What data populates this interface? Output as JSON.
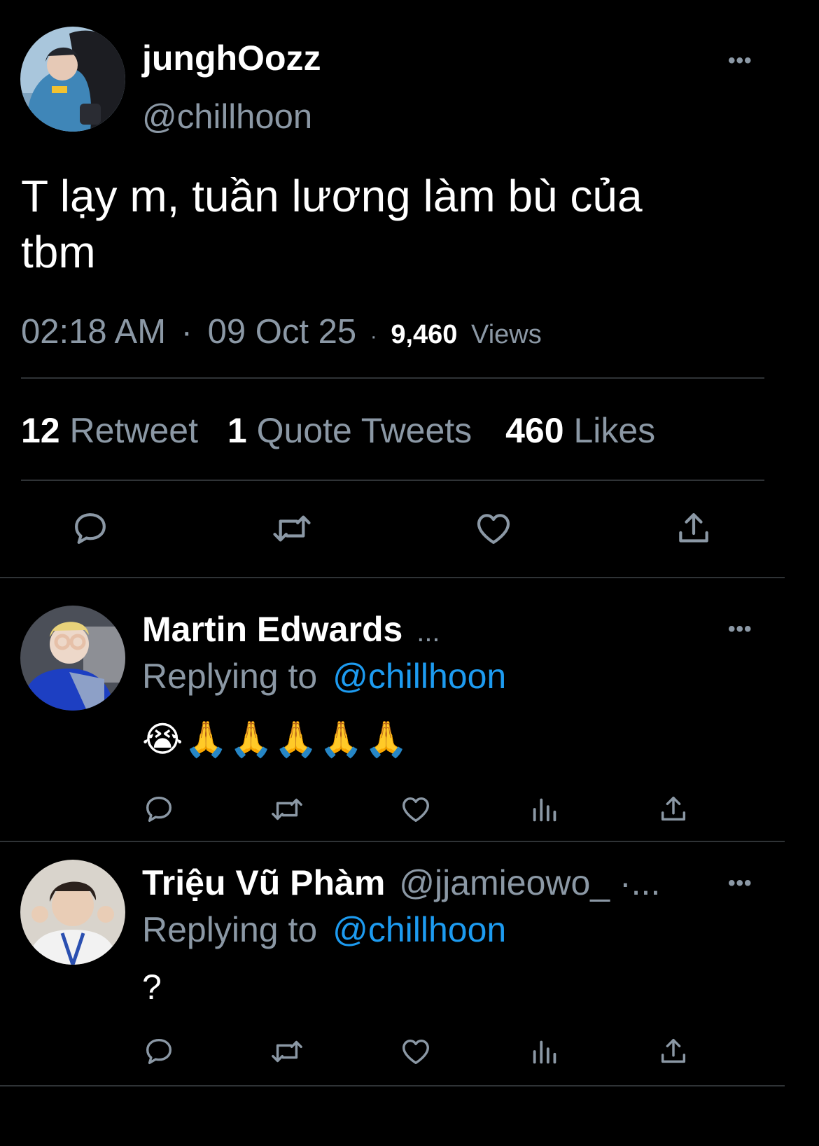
{
  "tweet": {
    "display_name": "junghOozz",
    "handle": "@chillhoon",
    "text_line1": "T lạy m, tuần lương làm bù của",
    "text_line2": "tbm",
    "time": "02:18 AM",
    "sep": "·",
    "date": "09 Oct 25",
    "views_count": "9,460",
    "views_label": "Views",
    "stats": {
      "retweets_count": "12",
      "retweets_label": "Retweet",
      "quotes_count": "1",
      "quotes_label": "Quote Tweets",
      "likes_count": "460",
      "likes_label": "Likes"
    },
    "more_glyph": "•••"
  },
  "replies": [
    {
      "display_name": "Martin Edwards",
      "name_suffix": "...",
      "replying_label": "Replying to",
      "replying_handle": "@chillhoon",
      "text": "😭🙏🙏🙏🙏🙏",
      "more_glyph": "•••"
    },
    {
      "display_name": "Triệu Vũ Phàm",
      "handle_suffix": "@jjamieowo_ ·...",
      "replying_label": "Replying to",
      "replying_handle": "@chillhoon",
      "text": "?",
      "more_glyph": "•••"
    }
  ],
  "icons": {
    "reply": "reply-icon",
    "retweet": "retweet-icon",
    "like": "heart-icon",
    "views": "views-icon",
    "share": "share-icon",
    "more": "more-icon"
  },
  "colors": {
    "background": "#000000",
    "text": "#ffffff",
    "muted": "#8b98a5",
    "link": "#1d9bf0",
    "divider": "#2f3336"
  }
}
